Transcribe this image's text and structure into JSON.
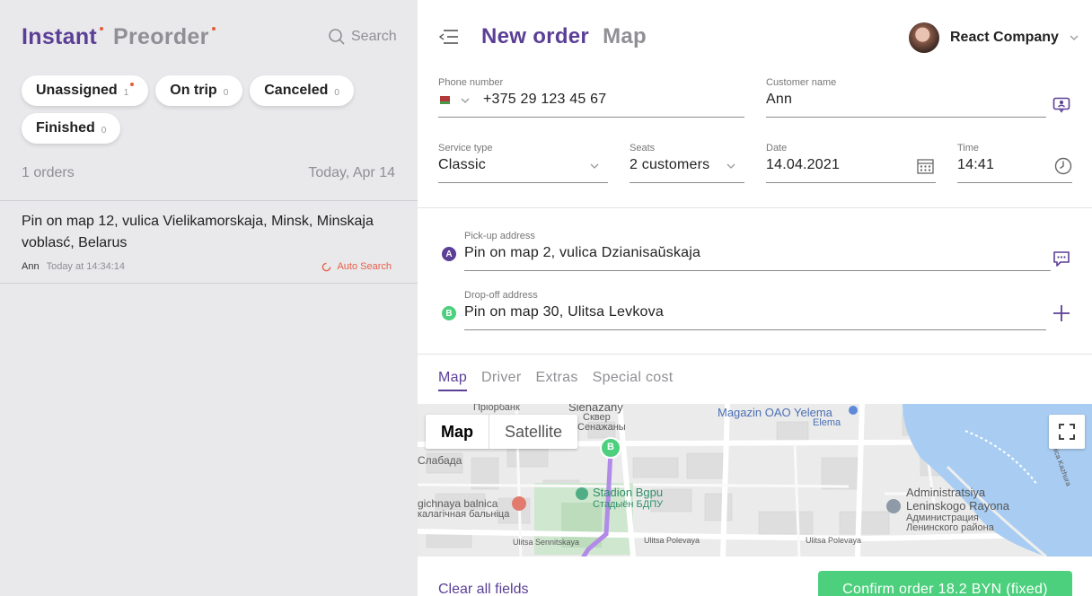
{
  "left": {
    "mode_tabs": [
      {
        "label": "Instant",
        "active": true
      },
      {
        "label": "Preorder",
        "active": false
      }
    ],
    "search_label": "Search",
    "filters": [
      {
        "label": "Unassigned",
        "count": "1",
        "alert": true
      },
      {
        "label": "On trip",
        "count": "0",
        "alert": false
      },
      {
        "label": "Canceled",
        "count": "0",
        "alert": false
      },
      {
        "label": "Finished",
        "count": "0",
        "alert": false
      }
    ],
    "orders_count": "1 orders",
    "orders_date": "Today, Apr 14",
    "order": {
      "address": "Pin on map 12, vulica Vielikamorskaja, Minsk, Minskaja voblasć, Belarus",
      "user": "Ann",
      "time": "Today at 14:34:14",
      "status": "Auto Search"
    }
  },
  "header": {
    "tabs": [
      {
        "label": "New order",
        "active": true
      },
      {
        "label": "Map",
        "active": false
      }
    ],
    "company": "React Company"
  },
  "form": {
    "phone": {
      "label": "Phone number",
      "value": "+375 29 123 45 67"
    },
    "customer": {
      "label": "Customer name",
      "value": "Ann"
    },
    "service": {
      "label": "Service type",
      "value": "Classic"
    },
    "seats": {
      "label": "Seats",
      "value": "2 customers"
    },
    "date": {
      "label": "Date",
      "value": "14.04.2021"
    },
    "time": {
      "label": "Time",
      "value": "14:41"
    },
    "pickup": {
      "label": "Pick-up address",
      "value": "Pin on map 2, vulica Dzianisaŭskaja",
      "marker": "A"
    },
    "dropoff": {
      "label": "Drop-off address",
      "value": "Pin on map 30, Ulitsa Levkova",
      "marker": "B"
    }
  },
  "map_tabs": [
    {
      "label": "Map",
      "active": true
    },
    {
      "label": "Driver",
      "active": false
    },
    {
      "label": "Extras",
      "active": false
    },
    {
      "label": "Special cost",
      "active": false
    }
  ],
  "map": {
    "type_buttons": [
      "Map",
      "Satellite"
    ],
    "marker": "B",
    "labels": {
      "l1": "Пріорбанк",
      "l2": "Sienazany",
      "l3": "Сквер",
      "l4": "Сенажаны",
      "l5": "Magazin OAO Yelema",
      "l6": "Elema",
      "l7": "Слабада",
      "l8": "gichnaya balnica",
      "l9": "калагічная бальніца",
      "l10": "Stadion Bgpu",
      "l11": "Стадыён БДПУ",
      "l12": "Ulitsa Sennitskaya",
      "l13": "Ulitsa Polevaya",
      "l14": "Ulitsa Polevaya",
      "l15": "Administratsiya",
      "l16": "Leninskogo Rayona",
      "l17": "Администрация",
      "l18": "Ленинского района",
      "l19": "vulica Kazhura"
    }
  },
  "actions": {
    "clear": "Clear all fields",
    "confirm": "Confirm order 18.2 BYN (fixed)"
  },
  "colors": {
    "brand": "#5b3f96",
    "confirm": "#4cd07d",
    "alert": "#e85b3a",
    "pickup_marker": "#5b3f96",
    "dropoff_marker": "#4cd07d"
  }
}
